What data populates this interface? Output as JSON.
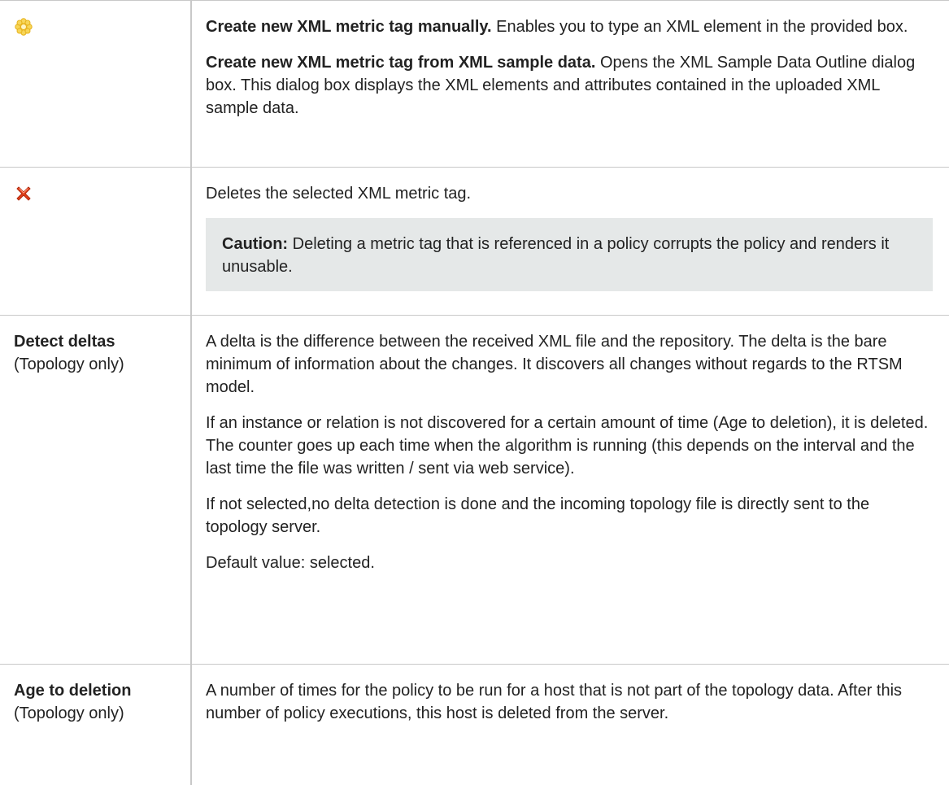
{
  "rows": [
    {
      "icon": "new-tag-icon",
      "paragraphs": [
        {
          "bold": "Create new XML metric tag manually.",
          "text": " Enables you to type an XML element in the provided box."
        },
        {
          "bold": "Create new XML metric tag from XML sample data.",
          "text": " Opens the XML Sample Data Outline dialog box. This dialog box displays the XML elements and attributes contained in the uploaded XML sample data."
        }
      ]
    },
    {
      "icon": "delete-icon",
      "paragraphs": [
        {
          "text": "Deletes the selected XML metric tag."
        }
      ],
      "caution": {
        "bold": "Caution:",
        "text": " Deleting a metric tag that is referenced in a policy corrupts the policy and renders it unusable."
      }
    },
    {
      "label": "Detect deltas",
      "sublabel": "(Topology only)",
      "paragraphs": [
        {
          "text": "A delta is the difference between the received XML file and the repository. The delta is the bare minimum of information about the changes. It discovers all changes without regards to the RTSM model."
        },
        {
          "text": "If an instance or relation is not discovered for a certain amount of time (Age to deletion), it is deleted. The counter goes up each time when the algorithm is running (this depends on the interval and the last time the file was written / sent via web service)."
        },
        {
          "text": "If not selected,no delta detection is done and the incoming topology file is directly sent to the topology server."
        },
        {
          "text": "Default value: selected."
        }
      ]
    },
    {
      "label": "Age to deletion",
      "sublabel": "(Topology only)",
      "paragraphs": [
        {
          "text": "A number of times for the policy to be run for a host that is not part of the topology data. After this number of policy executions, this host is deleted from the server."
        }
      ]
    }
  ],
  "colors": {
    "border": "#c8c8c8",
    "caution_bg": "#e5e8e8",
    "text": "#222222",
    "new_icon": "#f2c12e",
    "delete_icon": "#e0401c"
  }
}
